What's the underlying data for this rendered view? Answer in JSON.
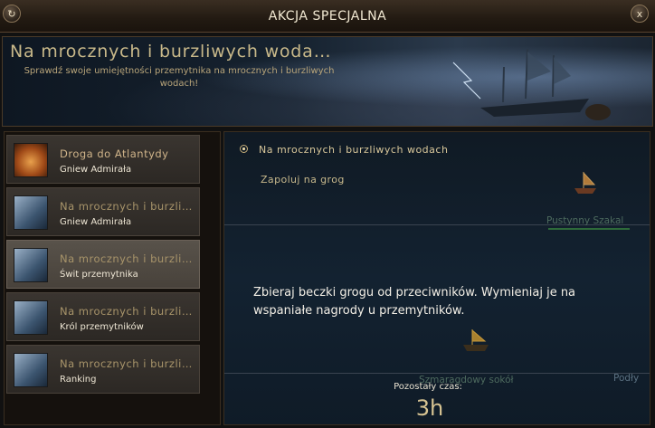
{
  "window": {
    "title": "AKCJA SPECJALNA",
    "refresh_icon": "refresh-icon",
    "close_label": "x"
  },
  "banner": {
    "title": "Na mrocznych i burzliwych woda…",
    "subtitle": "Sprawdź swoje umiejętności przemytnika na mrocznych i burzliwych wodach!"
  },
  "events": [
    {
      "name": "Droga do Atlantydy",
      "sub": "Gniew Admirała",
      "icon": "atlantis-icon",
      "active": false
    },
    {
      "name": "Na mrocznych i burzli…",
      "sub": "Gniew Admirała",
      "icon": "ship-icon",
      "active": false
    },
    {
      "name": "Na mrocznych i burzli…",
      "sub": "Świt przemytnika",
      "icon": "ship-icon",
      "active": true
    },
    {
      "name": "Na mrocznych i burzli…",
      "sub": "Król przemytników",
      "icon": "ship-icon",
      "active": false
    },
    {
      "name": "Na mrocznych i burzli…",
      "sub": "Ranking",
      "icon": "ship-icon",
      "active": false
    }
  ],
  "quest": {
    "main": "Na mrocznych i burzliwych wodach",
    "sub": "Zapoluj na grog",
    "description": "Zbieraj beczki grogu od przeciwników. Wymieniaj je na wspaniałe nagrody u przemytników."
  },
  "map": {
    "labels": [
      "Pustynny Szakal",
      "Szmaragdowy sokół",
      "Podły"
    ]
  },
  "timer": {
    "label": "Pozostały czas:",
    "value": "3h"
  },
  "colors": {
    "accent_gold": "#d6c392",
    "panel_dark": "#101a24"
  }
}
